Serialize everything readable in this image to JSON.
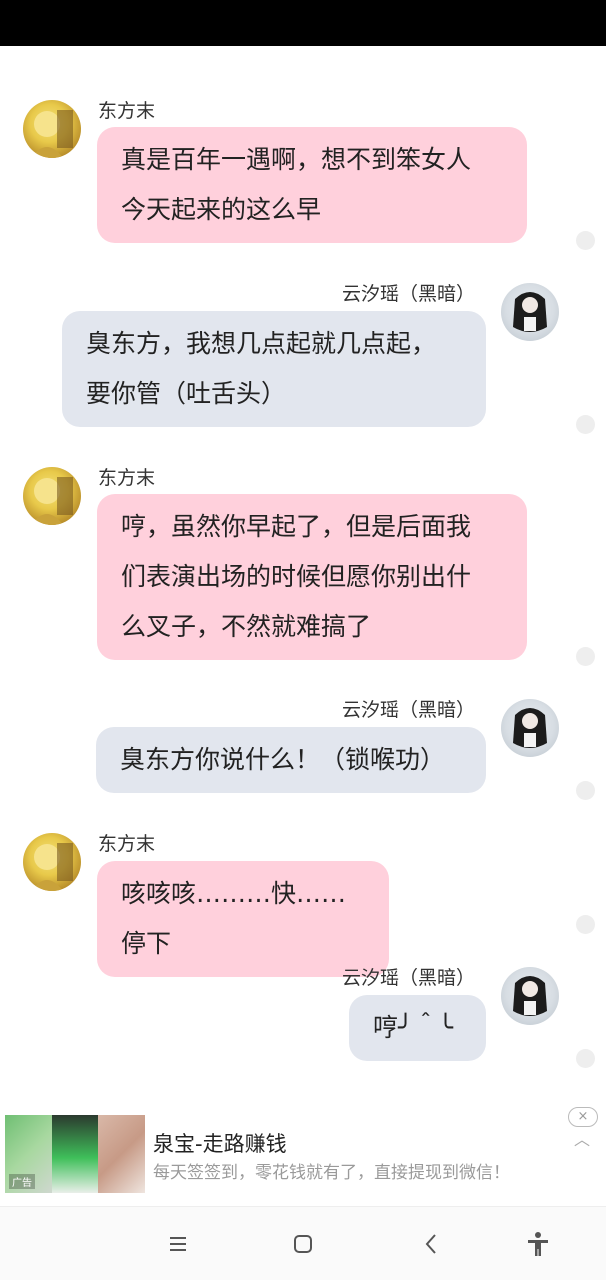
{
  "messages": [
    {
      "sender": "东方末",
      "side": "left",
      "lines": [
        "真是百年一遇啊，想不到笨女人",
        "今天起来的这么早"
      ]
    },
    {
      "sender": "云汐瑶（黑暗）",
      "side": "right",
      "lines": [
        "臭东方，我想几点起就几点起，",
        "要你管（吐舌头）"
      ]
    },
    {
      "sender": "东方末",
      "side": "left",
      "lines": [
        "哼，虽然你早起了，但是后面我",
        "们表演出场的时候但愿你别出什",
        "么叉子，不然就难搞了"
      ]
    },
    {
      "sender": "云汐瑶（黑暗）",
      "side": "right",
      "lines": [
        "臭东方你说什么！（锁喉功）"
      ]
    },
    {
      "sender": "东方末",
      "side": "left",
      "lines": [
        "咳咳咳………快……停下"
      ]
    },
    {
      "sender": "云汐瑶（黑暗）",
      "side": "right",
      "lines": [
        "哼╯＾╰"
      ]
    }
  ],
  "ad": {
    "title": "泉宝-走路赚钱",
    "description": "每天签签到，零花钱就有了，直接提现到微信！",
    "tag": "广告",
    "close_label": "×"
  },
  "nav": {
    "menu_icon": "menu-icon",
    "home_icon": "home-icon",
    "back_icon": "back-icon",
    "accessibility_icon": "accessibility-icon"
  },
  "colors": {
    "left_bubble": "#ffd0dc",
    "right_bubble": "#e2e6ee",
    "status_bar": "#000000"
  }
}
